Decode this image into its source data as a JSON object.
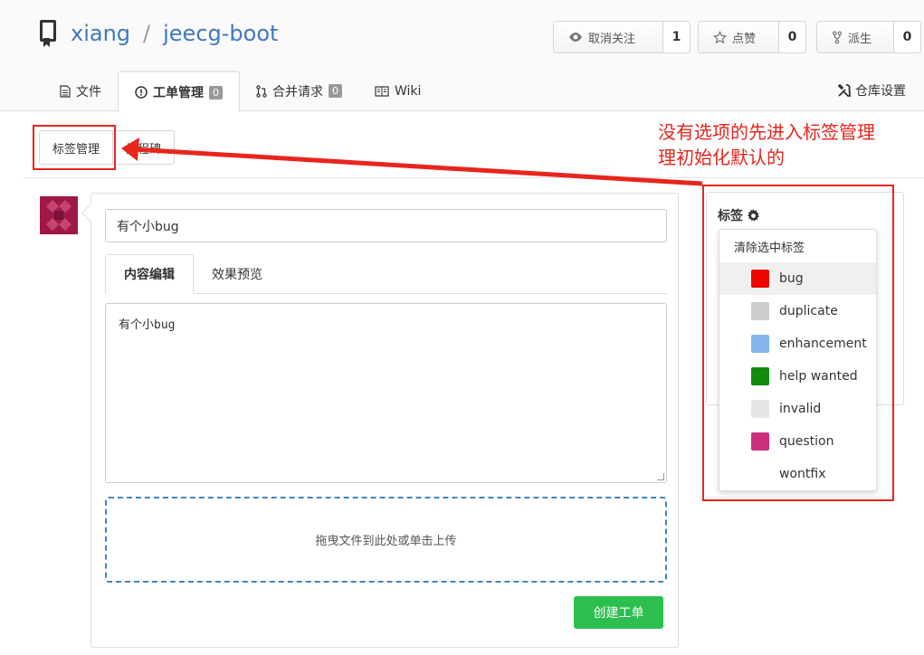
{
  "repo": {
    "owner": "xiang",
    "separator": "/",
    "name": "jeecg-boot"
  },
  "stats": [
    {
      "label": "取消关注",
      "count": "1",
      "icon": "eye-icon"
    },
    {
      "label": "点赞",
      "count": "0",
      "icon": "star-icon"
    },
    {
      "label": "派生",
      "count": "0",
      "icon": "fork-icon"
    }
  ],
  "tabs": [
    {
      "label": "文件",
      "icon": "file-icon"
    },
    {
      "label": "工单管理",
      "badge": "0",
      "icon": "issue-icon"
    },
    {
      "label": "合并请求",
      "badge": "0",
      "icon": "pull-request-icon"
    },
    {
      "label": "Wiki",
      "icon": "book-icon"
    }
  ],
  "settings_label": "仓库设置",
  "sub_toolbar": {
    "labels_button": "标签管理",
    "milestones_button": "里程碑"
  },
  "annotation": {
    "line1": "没有选项的先进入标签管理",
    "line2": "理初始化默认的"
  },
  "issue_form": {
    "title_value": "有个小bug",
    "edit_tab": "内容编辑",
    "preview_tab": "效果预览",
    "content_value": "有个小bug",
    "dropzone_text": "拖曳文件到此处或单击上传",
    "submit_label": "创建工单"
  },
  "sidebar": {
    "labels_title": "标签",
    "clear_label": "清除选中标签",
    "labels": [
      {
        "name": "bug",
        "color": "#ee0701"
      },
      {
        "name": "duplicate",
        "color": "#cccccc"
      },
      {
        "name": "enhancement",
        "color": "#84b6eb"
      },
      {
        "name": "help wanted",
        "color": "#128a0c"
      },
      {
        "name": "invalid",
        "color": "#e6e6e6"
      },
      {
        "name": "question",
        "color": "#cc317c"
      },
      {
        "name": "wontfix",
        "color": ""
      }
    ]
  },
  "colors": {
    "link": "#4078c0",
    "annotation": "#e8251d",
    "submit": "#2cbe4e",
    "dropzone_border": "#4183c4"
  }
}
